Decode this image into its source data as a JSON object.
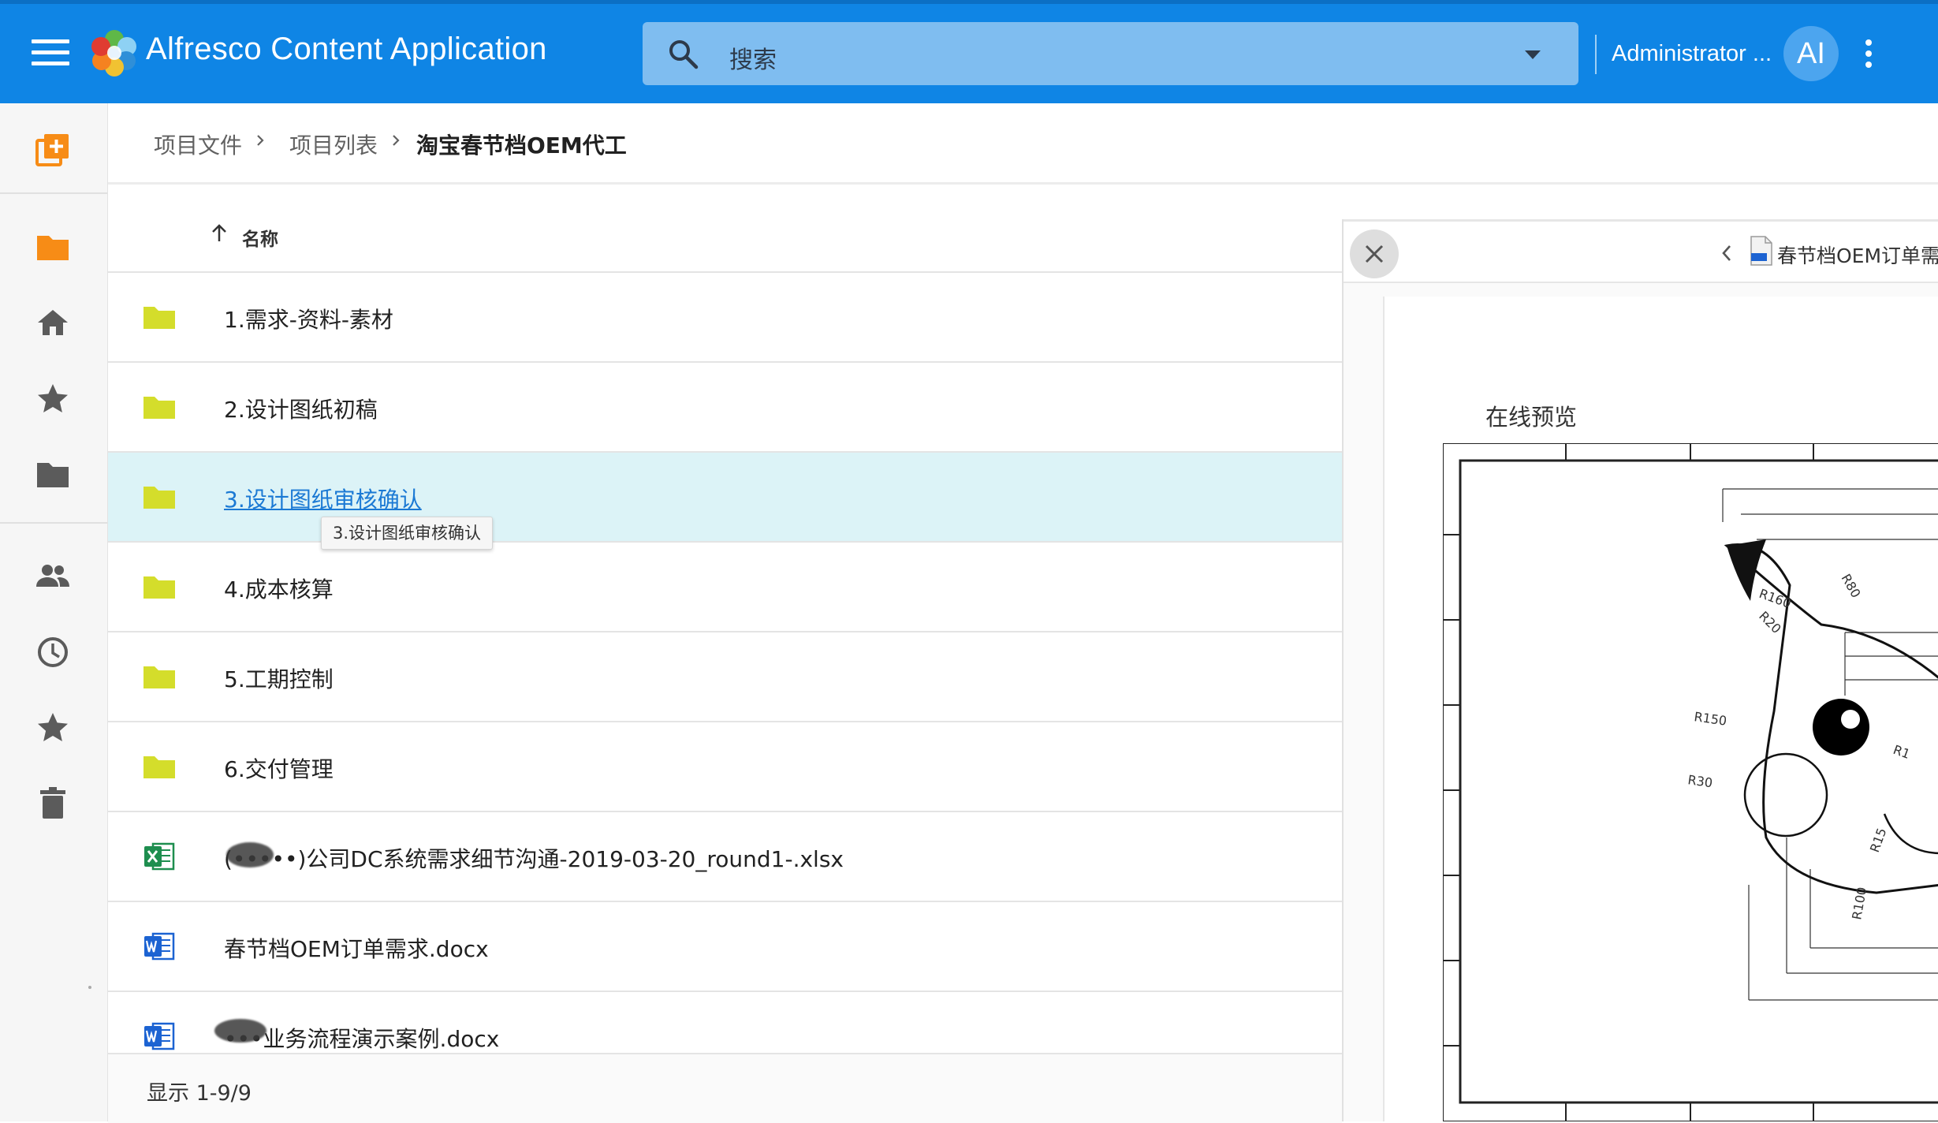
{
  "header": {
    "app_title": "Alfresco Content Application",
    "search_placeholder": "搜索",
    "user_name": "Administrator ...",
    "user_initials": "AI"
  },
  "sidebar": {
    "icons": [
      "create-new-icon",
      "folder-icon",
      "home-icon",
      "favorites-star-icon",
      "libraries-folder-icon",
      "people-icon",
      "recent-clock-icon",
      "favorites-star-icon",
      "trash-icon"
    ]
  },
  "breadcrumb": {
    "items": [
      "项目文件",
      "项目列表"
    ],
    "current": "淘宝春节档OEM代工"
  },
  "list": {
    "column_name": "名称",
    "rows": [
      {
        "name": "1.需求-资料-素材",
        "type": "folder"
      },
      {
        "name": "2.设计图纸初稿",
        "type": "folder"
      },
      {
        "name": "3.设计图纸审核确认",
        "type": "folder"
      },
      {
        "name": "4.成本核算",
        "type": "folder"
      },
      {
        "name": "5.工期控制",
        "type": "folder"
      },
      {
        "name": "6.交付管理",
        "type": "folder"
      },
      {
        "name": "(•••••)公司DC系统需求细节沟通-2019-03-20_round1-.xlsx",
        "type": "excel"
      },
      {
        "name": "春节档OEM订单需求.docx",
        "type": "word"
      },
      {
        "name": "•••业务流程演示案例.docx",
        "type": "word"
      }
    ],
    "tooltip": "3.设计图纸审核确认",
    "footer": "显示 1-9/9"
  },
  "viewer": {
    "file_name": "春节档OEM订单需求",
    "preview_title": "在线预览",
    "file_icon": "dwg-file-icon",
    "drawing_labels": [
      "R160",
      "R20",
      "R80",
      "R150",
      "R1",
      "R30",
      "R15",
      "R100"
    ]
  },
  "colors": {
    "header_bg": "#0f85e5",
    "folder": "#d4dd2b",
    "selected_row": "#dcf3f7",
    "link": "#1b79d4",
    "sidebar_accent": "#f78c16"
  }
}
